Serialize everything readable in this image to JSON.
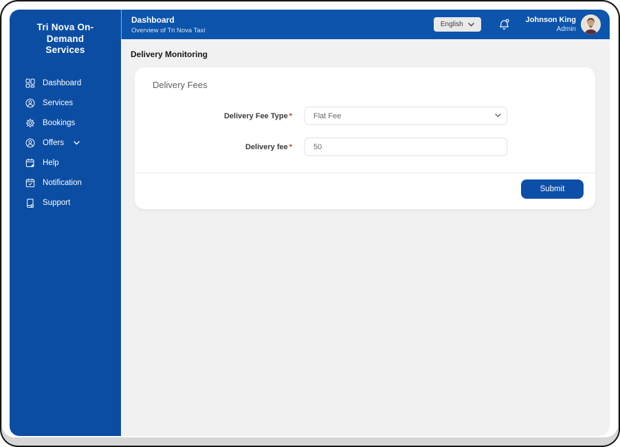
{
  "sidebar": {
    "brand": "Tri Nova On-Demand Services",
    "items": [
      {
        "label": "Dashboard",
        "icon": "dashboard-grid-icon"
      },
      {
        "label": "Services",
        "icon": "user-circle-icon"
      },
      {
        "label": "Bookings",
        "icon": "gear-icon"
      },
      {
        "label": "Offers",
        "icon": "user-circle-icon",
        "has_chevron": true
      },
      {
        "label": "Help",
        "icon": "calendar-pen-icon"
      },
      {
        "label": "Notification",
        "icon": "calendar-check-icon"
      },
      {
        "label": "Support",
        "icon": "book-badge-icon"
      }
    ]
  },
  "header": {
    "title": "Dashboard",
    "subtitle": "Overview of Tri Nova Taxi",
    "language": "English",
    "user": {
      "name": "Johnson King",
      "role": "Admin"
    }
  },
  "main": {
    "page_heading": "Delivery Monitoring",
    "card": {
      "title": "Delivery Fees",
      "fields": [
        {
          "label": "Delivery Fee Type",
          "required": "*",
          "type": "select",
          "value": "Flat Fee"
        },
        {
          "label": "Delivery fee",
          "required": "*",
          "type": "input",
          "value": "50"
        }
      ],
      "submit_label": "Submit"
    }
  },
  "colors": {
    "sidebar_blue": "#0b4da2",
    "header_blue": "#0c54ac",
    "submit_blue": "#0d4fa8",
    "content_bg": "#f2f1f1",
    "required_red": "#c13c3c"
  }
}
